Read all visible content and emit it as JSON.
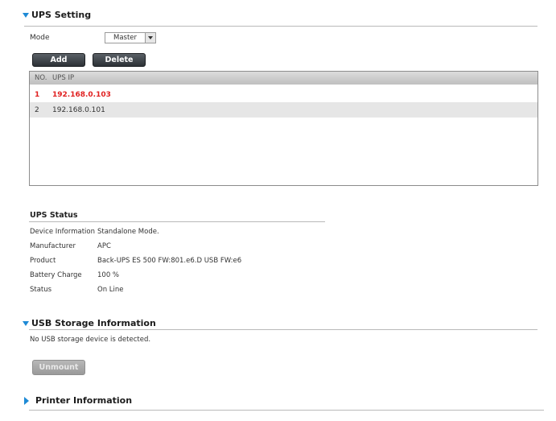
{
  "ups_setting": {
    "title": "UPS Setting",
    "mode_label": "Mode",
    "mode_value": "Master",
    "add_label": "Add",
    "delete_label": "Delete",
    "table": {
      "headers": [
        "NO.",
        "UPS IP"
      ],
      "rows": [
        {
          "no": "1",
          "ip": "192.168.0.103"
        },
        {
          "no": "2",
          "ip": "192.168.0.101"
        }
      ]
    }
  },
  "ups_status": {
    "title": "UPS Status",
    "rows": [
      {
        "key": "Device Information",
        "value": "Standalone Mode."
      },
      {
        "key": "Manufacturer",
        "value": "APC"
      },
      {
        "key": "Product",
        "value": "Back-UPS ES 500 FW:801.e6.D USB FW:e6"
      },
      {
        "key": "Battery Charge",
        "value": "100 %"
      },
      {
        "key": "Status",
        "value": "On Line"
      }
    ]
  },
  "usb_storage": {
    "title": "USB Storage Information",
    "message": "No USB storage device is detected.",
    "unmount_label": "Unmount"
  },
  "printer": {
    "title": "Printer Information"
  },
  "colors": {
    "accent": "#1e8ad6",
    "selected_row_text": "#e02020"
  }
}
